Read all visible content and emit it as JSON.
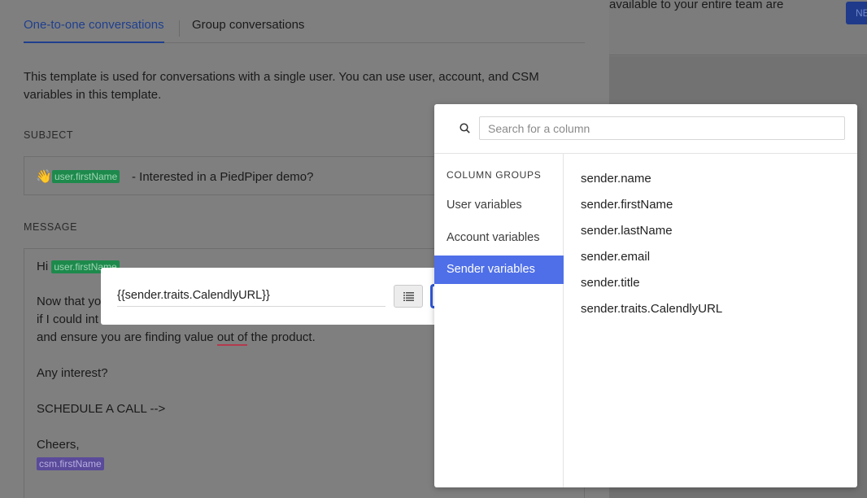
{
  "tabs": [
    {
      "label": "One-to-one conversations"
    },
    {
      "label": "Group conversations"
    }
  ],
  "description": "This template is used for conversations with a single user. You can use user, account, and CSM variables in this template.",
  "subject": {
    "label": "SUBJECT",
    "emoji": "👋",
    "tag": "user.firstName",
    "text": "- Interested in a PiedPiper demo?"
  },
  "message": {
    "label": "MESSAGE",
    "greeting": "Hi",
    "greeting_tag": "user.firstName",
    "line1": "Now that yo",
    "line2": "if I could int",
    "line3_pre": "and ensure you are finding value ",
    "line3_squiggle": "out of",
    "line3_post": " the product.",
    "interest": "Any interest?",
    "cta": "SCHEDULE A CALL -->",
    "signoff": "Cheers,",
    "csm_tag": "csm.firstName"
  },
  "background_right": {
    "text": "available to your entire team are",
    "button_label": "NE"
  },
  "url_popup": {
    "value": "{{sender.traits.CalendlyURL}}"
  },
  "picker": {
    "search_placeholder": "Search for a column",
    "groups_title": "COLUMN GROUPS",
    "groups": [
      {
        "label": "User variables",
        "selected": false
      },
      {
        "label": "Account variables",
        "selected": false
      },
      {
        "label": "Sender variables",
        "selected": true
      }
    ],
    "columns": [
      "sender.name",
      "sender.firstName",
      "sender.lastName",
      "sender.email",
      "sender.title",
      "sender.traits.CalendlyURL"
    ]
  },
  "colors": {
    "accent": "#4f6fe8",
    "tab_active": "#1f3f8e",
    "user_tag": "#1d8a4c",
    "csm_tag": "#5a4a9a"
  }
}
